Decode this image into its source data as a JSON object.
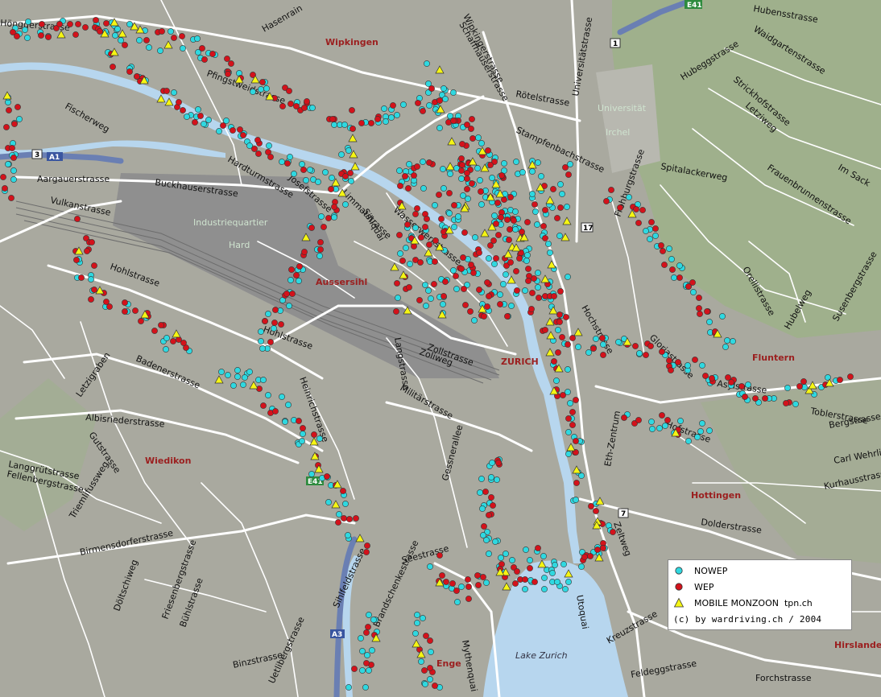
{
  "colors": {
    "background": "#a9a99f",
    "street": "#ffffff",
    "water": "#b7d6ee",
    "rail_area": "#8f8f8f",
    "green_area": "#9fb08c",
    "nowep": "#2fd8e0",
    "wep": "#d3121b",
    "mobile": "#f5f514",
    "district_label": "#9b1f1f",
    "highway": "#6a7fb3"
  },
  "districts": [
    "Wipkingen",
    "Aussersihl",
    "Wiedikon",
    "Fluntern",
    "Hottingen",
    "Hirslanden",
    "Enge",
    "ZURICH"
  ],
  "area_labels": [
    "Industriequartier",
    "Hard",
    "Universität",
    "Irchel"
  ],
  "water_labels": [
    "Lake Zurich"
  ],
  "street_labels": [
    "Hönggerstrasse",
    "Wipkingerstrasse",
    "Hubensstrasse",
    "Waidgartenstrasse",
    "Hubeggstrasse",
    "Strickhofstrasse",
    "Letziweg",
    "Spitalackerweg",
    "Frauenbrunnenstrasse",
    "Im Sack",
    "Hasenrain",
    "Aargauerstrasse",
    "Vulkanstrasse",
    "Hohlstrasse",
    "Buckhauserstrasse",
    "Fischerweg",
    "Badenerstrasse",
    "Albisriederstrasse",
    "Letzigraben",
    "Gutstrasse",
    "Fellenbergstrasse",
    "Langgrütstrasse",
    "Triemlifussweg",
    "Birmensdorferstrasse",
    "Döltschiweg",
    "Friesenbergstrasse",
    "Bühlstrasse",
    "Binzstrasse",
    "Uetlibergstrasse",
    "Brandschenkestrasse",
    "Gessnerallee",
    "Zollstrasse",
    "Militärstrasse",
    "Langstrasse",
    "Hohlstrasse",
    "Limmatstrasse",
    "Sihlquai",
    "Wasserwerkstrasse",
    "Universitätstrasse",
    "Schaffhauserstrasse",
    "Frohburgstrasse",
    "Orellistrasse",
    "Hochstrasse",
    "Gloriastrasse",
    "Dolderstrasse",
    "Toblerstrasse",
    "Hofstrasse",
    "Kreuzstrasse",
    "Feldeggstrasse",
    "Forchstrasse",
    "Utoquai",
    "Mythenquai",
    "Seestrasse",
    "Sihlfeldstrasse",
    "Zoliweg",
    "Eth-Zentrum",
    "Zeltweg",
    "Asylstrasse",
    "Kurhausstrasse",
    "Bergstrasse",
    "Carl Wehrlistrasse",
    "Hubelweg",
    "Susenbergstrasse",
    "Rötelstrasse",
    "Stampfenbachstrasse",
    "Pfingstweidstrasse",
    "Hardturmstrasse",
    "Josefstrasse",
    "Heinrichstrasse"
  ],
  "route_badges": [
    "E41",
    "A1",
    "3",
    "17",
    "7",
    "1",
    "A3",
    "E41"
  ],
  "legend": {
    "items": [
      {
        "label": "NOWEP",
        "symbol": "circle",
        "color": "#2fd8e0"
      },
      {
        "label": "WEP",
        "symbol": "circle",
        "color": "#d3121b"
      },
      {
        "label": "MOBILE MONZOON  tpn.ch",
        "symbol": "triangle",
        "color": "#f5f514"
      }
    ],
    "copyright": "(c) by wardriving.ch / 2004"
  }
}
